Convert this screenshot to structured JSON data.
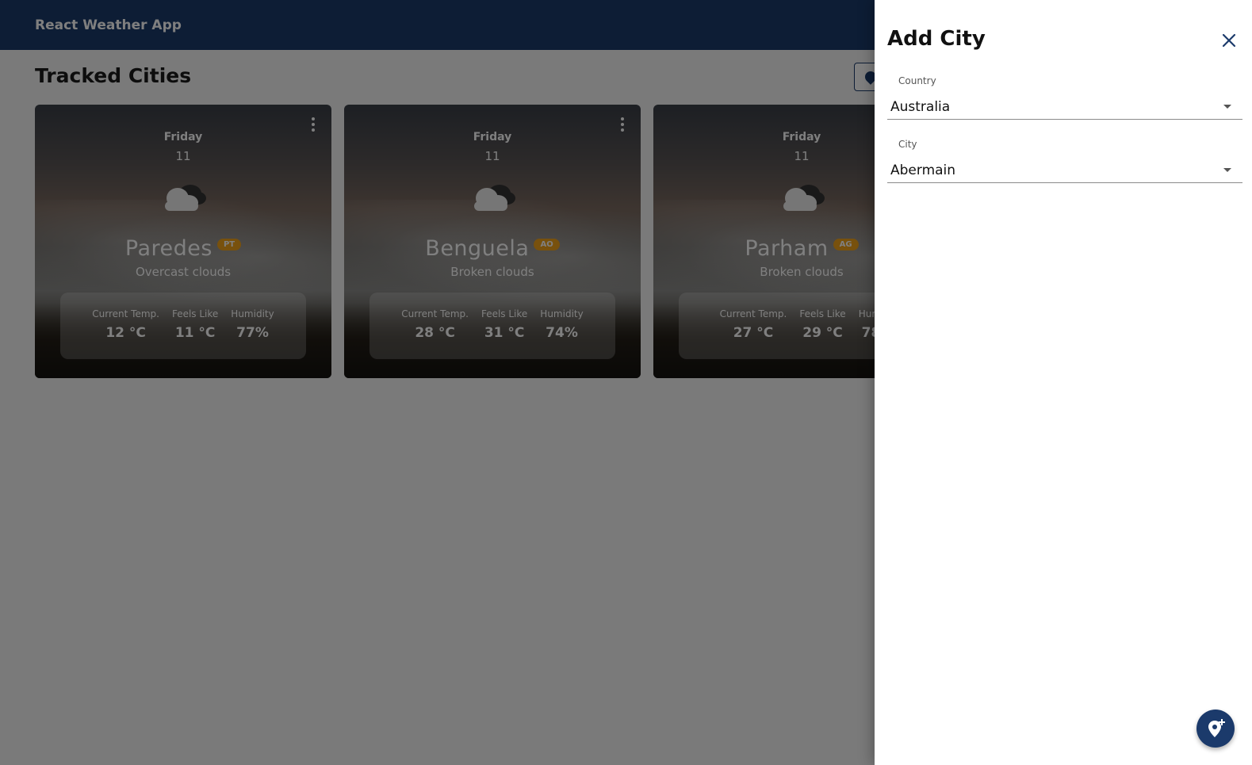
{
  "app": {
    "title": "React Weather App"
  },
  "page": {
    "heading": "Tracked Cities"
  },
  "cards": [
    {
      "day": "Friday",
      "date": "11",
      "city": "Paredes",
      "country_code": "PT",
      "condition": "Overcast clouds",
      "temp_label": "Current Temp.",
      "temp": "12 °C",
      "feels_label": "Feels Like",
      "feels": "11 °C",
      "humidity_label": "Humidity",
      "humidity": "77%"
    },
    {
      "day": "Friday",
      "date": "11",
      "city": "Benguela",
      "country_code": "AO",
      "condition": "Broken clouds",
      "temp_label": "Current Temp.",
      "temp": "28 °C",
      "feels_label": "Feels Like",
      "feels": "31 °C",
      "humidity_label": "Humidity",
      "humidity": "74%"
    },
    {
      "day": "Friday",
      "date": "11",
      "city": "Parham",
      "country_code": "AG",
      "condition": "Broken clouds",
      "temp_label": "Current Temp.",
      "temp": "27 °C",
      "feels_label": "Feels Like",
      "feels": "29 °C",
      "humidity_label": "Humi",
      "humidity": "78"
    }
  ],
  "drawer": {
    "title": "Add City",
    "country": {
      "label": "Country",
      "value": "Australia"
    },
    "city": {
      "label": "City",
      "value": "Abermain"
    }
  },
  "colors": {
    "primary": "#1b3a6b",
    "badge": "#f0a21a"
  }
}
